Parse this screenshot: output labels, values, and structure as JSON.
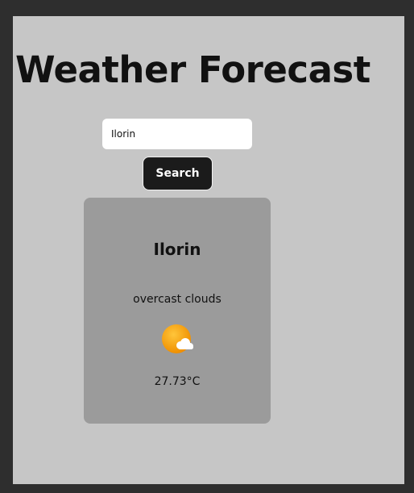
{
  "header": {
    "title": "Weather Forecast"
  },
  "search": {
    "value": "Ilorin",
    "button_label": "Search"
  },
  "weather": {
    "city": "Ilorin",
    "description": "overcast clouds",
    "icon": "partly-cloudy-icon",
    "temperature": "27.73°C"
  },
  "colors": {
    "page_background": "#2e2e2e",
    "app_background": "#c6c6c6",
    "card_background": "#9b9b9b",
    "button_background": "#1b1b1b",
    "sun": "#f5a00a",
    "cloud": "#ffffff"
  }
}
